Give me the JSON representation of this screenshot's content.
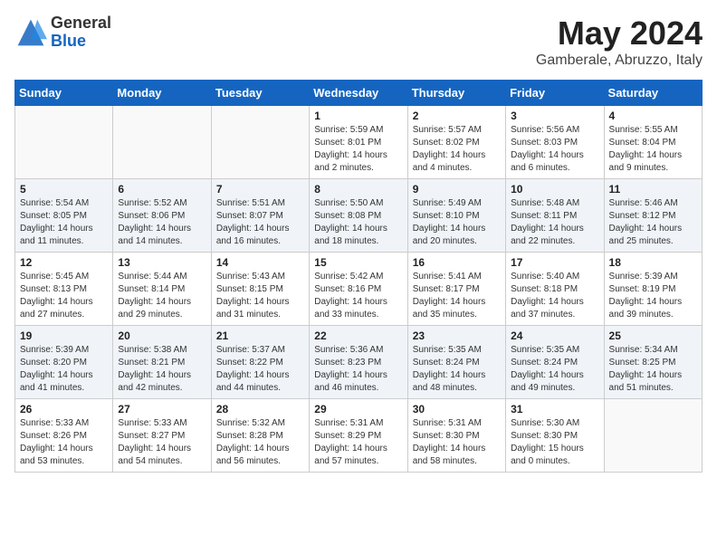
{
  "logo": {
    "general": "General",
    "blue": "Blue"
  },
  "title": "May 2024",
  "subtitle": "Gamberale, Abruzzo, Italy",
  "days_header": [
    "Sunday",
    "Monday",
    "Tuesday",
    "Wednesday",
    "Thursday",
    "Friday",
    "Saturday"
  ],
  "weeks": [
    [
      {
        "day": "",
        "info": ""
      },
      {
        "day": "",
        "info": ""
      },
      {
        "day": "",
        "info": ""
      },
      {
        "day": "1",
        "info": "Sunrise: 5:59 AM\nSunset: 8:01 PM\nDaylight: 14 hours\nand 2 minutes."
      },
      {
        "day": "2",
        "info": "Sunrise: 5:57 AM\nSunset: 8:02 PM\nDaylight: 14 hours\nand 4 minutes."
      },
      {
        "day": "3",
        "info": "Sunrise: 5:56 AM\nSunset: 8:03 PM\nDaylight: 14 hours\nand 6 minutes."
      },
      {
        "day": "4",
        "info": "Sunrise: 5:55 AM\nSunset: 8:04 PM\nDaylight: 14 hours\nand 9 minutes."
      }
    ],
    [
      {
        "day": "5",
        "info": "Sunrise: 5:54 AM\nSunset: 8:05 PM\nDaylight: 14 hours\nand 11 minutes."
      },
      {
        "day": "6",
        "info": "Sunrise: 5:52 AM\nSunset: 8:06 PM\nDaylight: 14 hours\nand 14 minutes."
      },
      {
        "day": "7",
        "info": "Sunrise: 5:51 AM\nSunset: 8:07 PM\nDaylight: 14 hours\nand 16 minutes."
      },
      {
        "day": "8",
        "info": "Sunrise: 5:50 AM\nSunset: 8:08 PM\nDaylight: 14 hours\nand 18 minutes."
      },
      {
        "day": "9",
        "info": "Sunrise: 5:49 AM\nSunset: 8:10 PM\nDaylight: 14 hours\nand 20 minutes."
      },
      {
        "day": "10",
        "info": "Sunrise: 5:48 AM\nSunset: 8:11 PM\nDaylight: 14 hours\nand 22 minutes."
      },
      {
        "day": "11",
        "info": "Sunrise: 5:46 AM\nSunset: 8:12 PM\nDaylight: 14 hours\nand 25 minutes."
      }
    ],
    [
      {
        "day": "12",
        "info": "Sunrise: 5:45 AM\nSunset: 8:13 PM\nDaylight: 14 hours\nand 27 minutes."
      },
      {
        "day": "13",
        "info": "Sunrise: 5:44 AM\nSunset: 8:14 PM\nDaylight: 14 hours\nand 29 minutes."
      },
      {
        "day": "14",
        "info": "Sunrise: 5:43 AM\nSunset: 8:15 PM\nDaylight: 14 hours\nand 31 minutes."
      },
      {
        "day": "15",
        "info": "Sunrise: 5:42 AM\nSunset: 8:16 PM\nDaylight: 14 hours\nand 33 minutes."
      },
      {
        "day": "16",
        "info": "Sunrise: 5:41 AM\nSunset: 8:17 PM\nDaylight: 14 hours\nand 35 minutes."
      },
      {
        "day": "17",
        "info": "Sunrise: 5:40 AM\nSunset: 8:18 PM\nDaylight: 14 hours\nand 37 minutes."
      },
      {
        "day": "18",
        "info": "Sunrise: 5:39 AM\nSunset: 8:19 PM\nDaylight: 14 hours\nand 39 minutes."
      }
    ],
    [
      {
        "day": "19",
        "info": "Sunrise: 5:39 AM\nSunset: 8:20 PM\nDaylight: 14 hours\nand 41 minutes."
      },
      {
        "day": "20",
        "info": "Sunrise: 5:38 AM\nSunset: 8:21 PM\nDaylight: 14 hours\nand 42 minutes."
      },
      {
        "day": "21",
        "info": "Sunrise: 5:37 AM\nSunset: 8:22 PM\nDaylight: 14 hours\nand 44 minutes."
      },
      {
        "day": "22",
        "info": "Sunrise: 5:36 AM\nSunset: 8:23 PM\nDaylight: 14 hours\nand 46 minutes."
      },
      {
        "day": "23",
        "info": "Sunrise: 5:35 AM\nSunset: 8:24 PM\nDaylight: 14 hours\nand 48 minutes."
      },
      {
        "day": "24",
        "info": "Sunrise: 5:35 AM\nSunset: 8:24 PM\nDaylight: 14 hours\nand 49 minutes."
      },
      {
        "day": "25",
        "info": "Sunrise: 5:34 AM\nSunset: 8:25 PM\nDaylight: 14 hours\nand 51 minutes."
      }
    ],
    [
      {
        "day": "26",
        "info": "Sunrise: 5:33 AM\nSunset: 8:26 PM\nDaylight: 14 hours\nand 53 minutes."
      },
      {
        "day": "27",
        "info": "Sunrise: 5:33 AM\nSunset: 8:27 PM\nDaylight: 14 hours\nand 54 minutes."
      },
      {
        "day": "28",
        "info": "Sunrise: 5:32 AM\nSunset: 8:28 PM\nDaylight: 14 hours\nand 56 minutes."
      },
      {
        "day": "29",
        "info": "Sunrise: 5:31 AM\nSunset: 8:29 PM\nDaylight: 14 hours\nand 57 minutes."
      },
      {
        "day": "30",
        "info": "Sunrise: 5:31 AM\nSunset: 8:30 PM\nDaylight: 14 hours\nand 58 minutes."
      },
      {
        "day": "31",
        "info": "Sunrise: 5:30 AM\nSunset: 8:30 PM\nDaylight: 15 hours\nand 0 minutes."
      },
      {
        "day": "",
        "info": ""
      }
    ]
  ]
}
